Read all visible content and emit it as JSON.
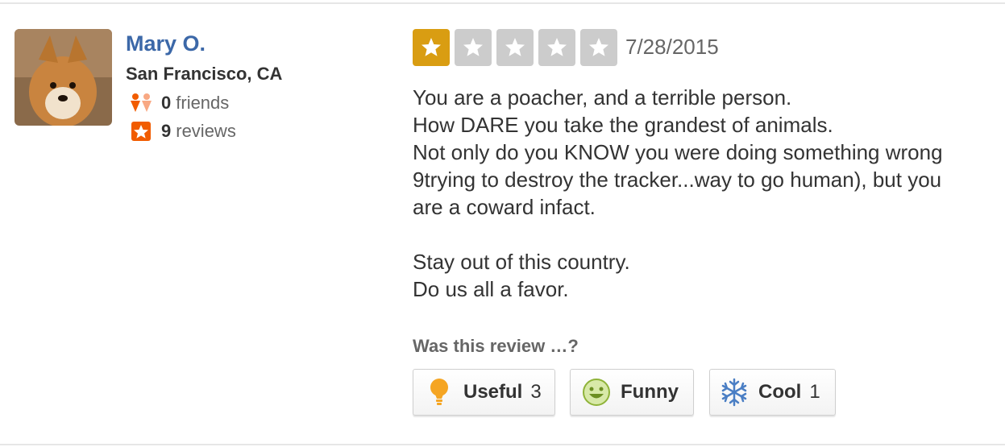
{
  "user": {
    "name": "Mary O.",
    "location": "San Francisco, CA",
    "friends_count": "0",
    "friends_label": "friends",
    "reviews_count": "9",
    "reviews_label": "reviews"
  },
  "review": {
    "rating": 1,
    "max_rating": 5,
    "date": "7/28/2015",
    "paragraph1": [
      "You are a poacher, and a terrible person.",
      "How DARE you take the grandest of animals.",
      "Not only do you KNOW you were doing something wrong",
      "9trying to destroy the tracker...way to go human), but you",
      "are a coward infact."
    ],
    "paragraph2": [
      "Stay out of this country.",
      "Do us all a favor."
    ]
  },
  "votes": {
    "prompt": "Was this review …?",
    "useful": {
      "label": "Useful",
      "count": "3",
      "icon": "lightbulb-icon"
    },
    "funny": {
      "label": "Funny",
      "count": "",
      "icon": "smiley-icon"
    },
    "cool": {
      "label": "Cool",
      "count": "1",
      "icon": "snowflake-icon"
    }
  },
  "colors": {
    "name_link": "#3c68a8",
    "star_on": "#d99d12",
    "star_off": "#cccccc",
    "brand_red": "#f15c00"
  }
}
